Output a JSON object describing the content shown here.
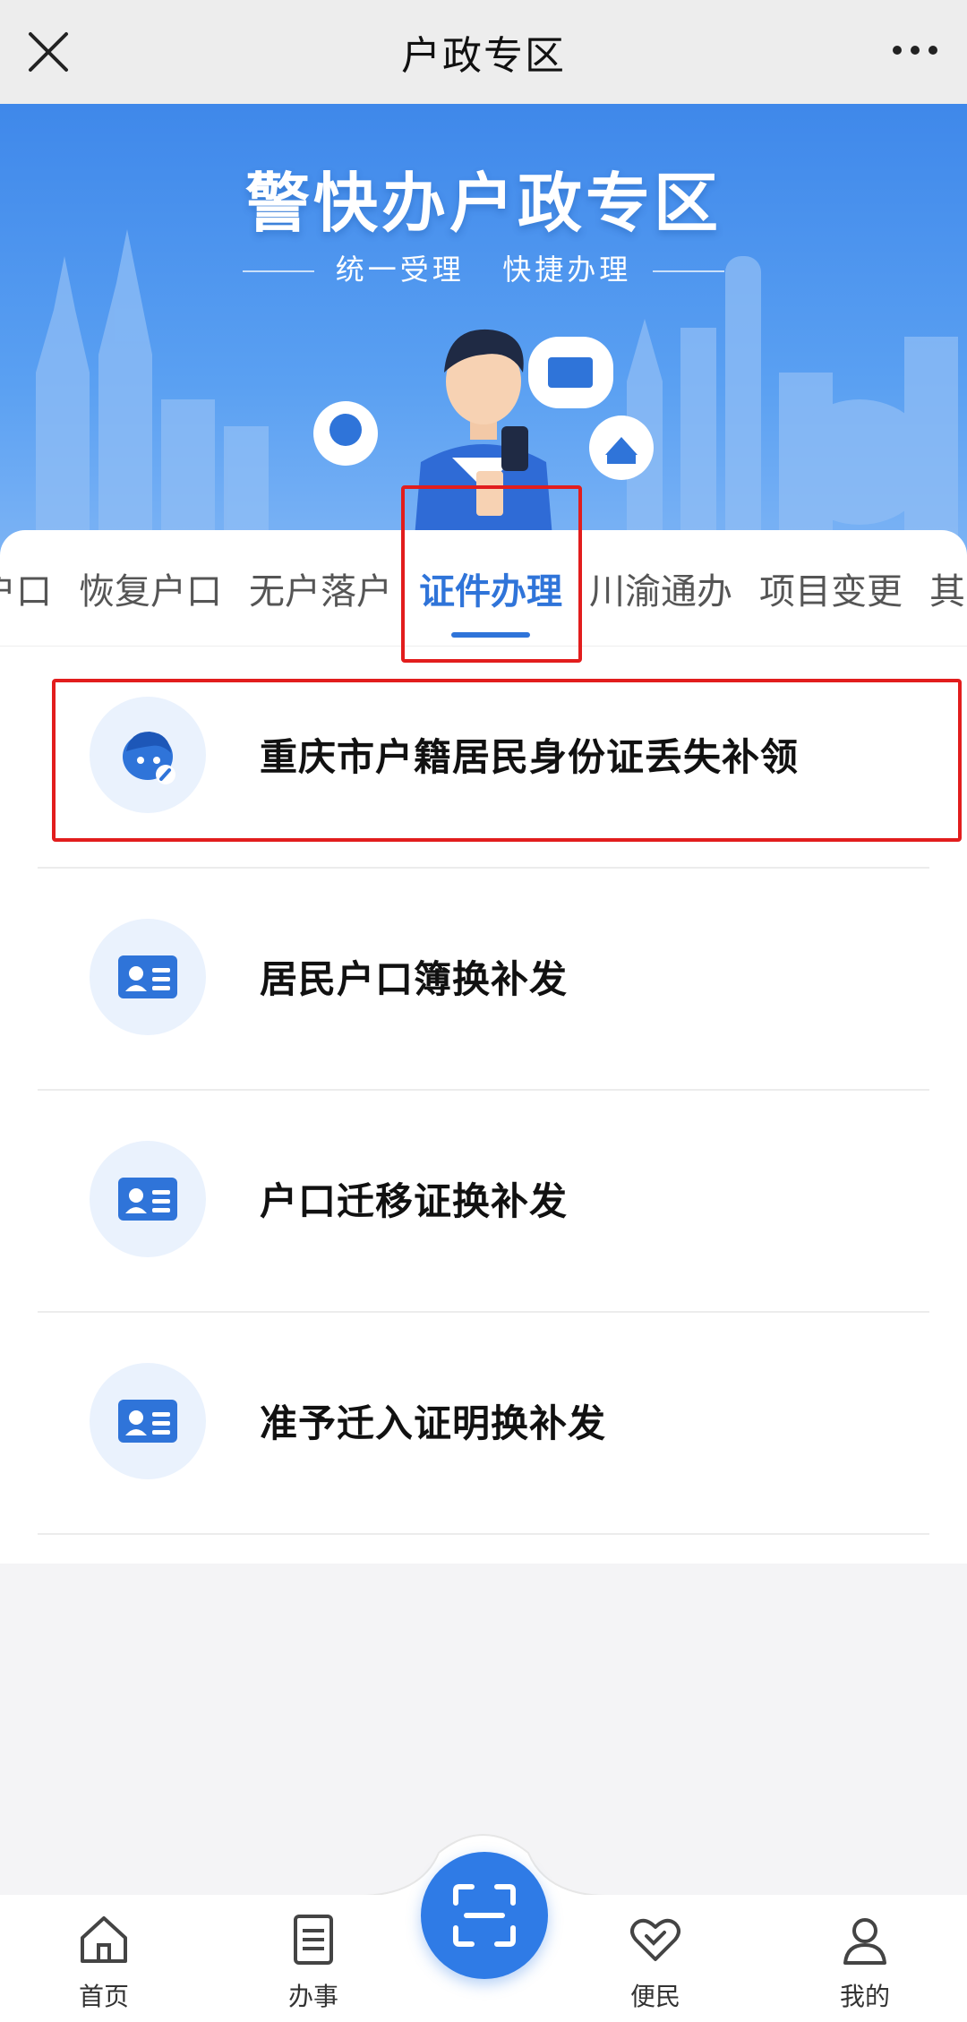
{
  "header": {
    "title": "户政专区"
  },
  "banner": {
    "title": "警快办户政专区",
    "subtitle_left": "统一受理",
    "subtitle_right": "快捷办理"
  },
  "tabs": [
    {
      "label": "户口"
    },
    {
      "label": "恢复户口"
    },
    {
      "label": "无户落户"
    },
    {
      "label": "证件办理",
      "active": true
    },
    {
      "label": "川渝通办"
    },
    {
      "label": "项目变更"
    },
    {
      "label": "其"
    }
  ],
  "items": [
    {
      "label": "重庆市户籍居民身份证丢失补领",
      "icon": "face-edit-icon"
    },
    {
      "label": "居民户口簿换补发",
      "icon": "id-card-icon"
    },
    {
      "label": "户口迁移证换补发",
      "icon": "id-card-icon"
    },
    {
      "label": "准予迁入证明换补发",
      "icon": "id-card-icon"
    }
  ],
  "bottom_nav": [
    {
      "label": "首页",
      "icon": "home-icon"
    },
    {
      "label": "办事",
      "icon": "document-icon"
    },
    {
      "label": "便民",
      "icon": "heart-icon"
    },
    {
      "label": "我的",
      "icon": "user-icon"
    }
  ],
  "colors": {
    "accent": "#2f74d9",
    "banner_blue": "#3f88ea",
    "annotation_red": "#e21d1d"
  }
}
